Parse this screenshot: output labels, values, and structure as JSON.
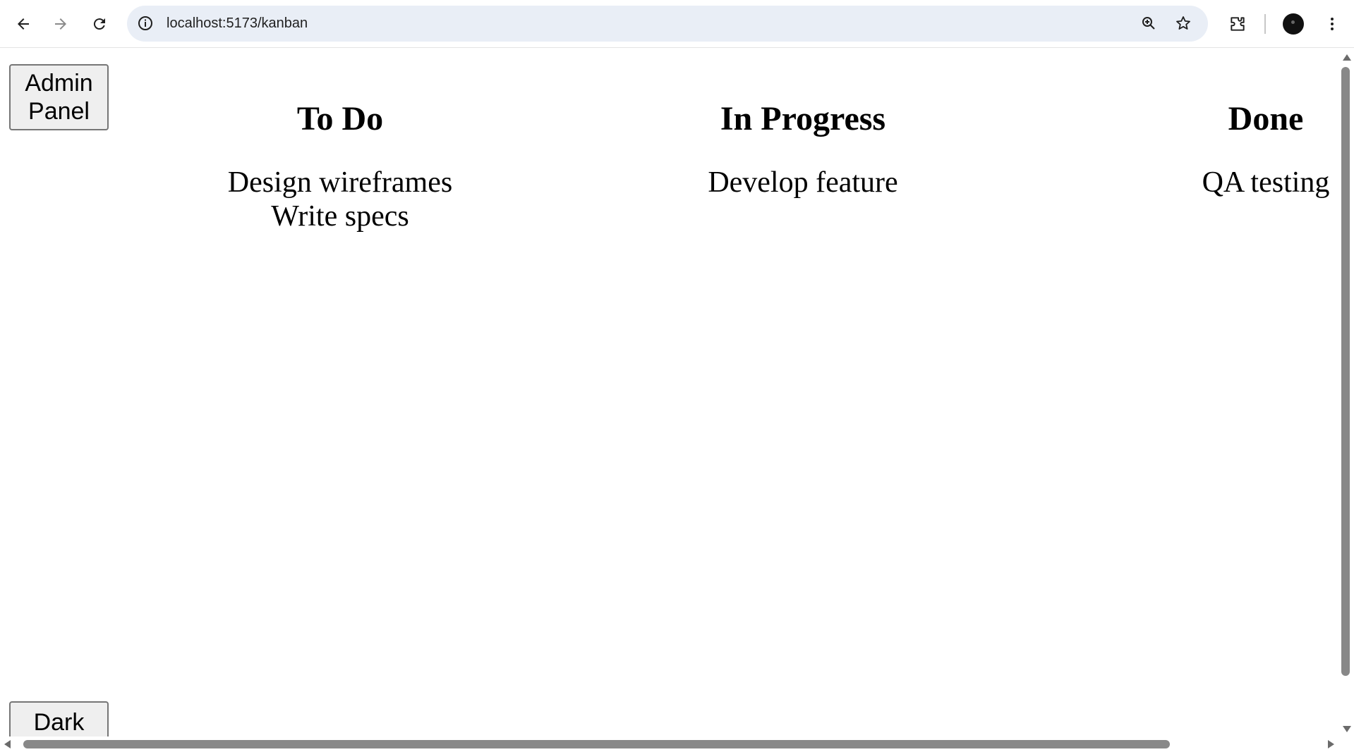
{
  "browser": {
    "url": "localhost:5173/kanban",
    "icons": {
      "back": "arrow-left-icon",
      "forward": "arrow-right-icon",
      "reload": "reload-icon",
      "site_info": "info-icon",
      "zoom": "zoom-icon",
      "bookmark": "star-icon",
      "extensions": "puzzle-icon",
      "menu": "kebab-menu-icon"
    }
  },
  "page": {
    "admin_button_label": "Admin Panel",
    "theme_button_label": "Dark",
    "columns": [
      {
        "title": "To Do",
        "cards": [
          "Design wireframes",
          "Write specs"
        ]
      },
      {
        "title": "In Progress",
        "cards": [
          "Develop feature"
        ]
      },
      {
        "title": "Done",
        "cards": [
          "QA testing"
        ]
      }
    ]
  },
  "colors": {
    "button_bg": "#efefef",
    "button_border": "#767676",
    "omnibox_bg": "#e9eef6",
    "scrollbar_thumb": "#888888"
  }
}
